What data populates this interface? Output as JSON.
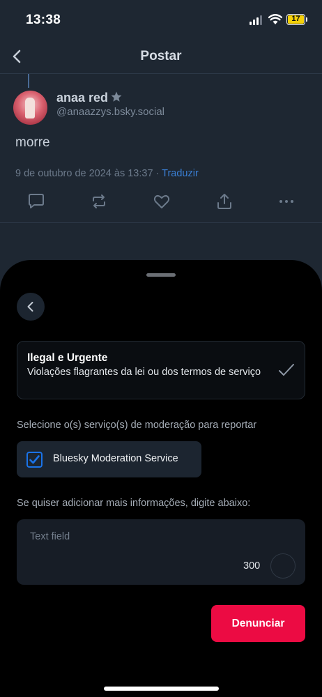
{
  "status_bar": {
    "time": "13:38",
    "battery_level": "17",
    "battery_color": "#f5d10a",
    "icons": [
      "signal-icon",
      "wifi-icon",
      "battery-icon"
    ]
  },
  "nav": {
    "title": "Postar",
    "back_icon": "chevron-left-icon"
  },
  "post": {
    "display_name": "anaa red",
    "verified_icon": "star-icon",
    "handle": "@anaazzys.bsky.social",
    "text": "morre",
    "timestamp": "9 de outubro de 2024 às 13:37",
    "separator": " · ",
    "translate_label": "Traduzir",
    "action_icons": [
      "reply-icon",
      "repost-icon",
      "like-icon",
      "share-icon",
      "more-icon"
    ]
  },
  "report_sheet": {
    "back_icon": "chevron-left-icon",
    "reason": {
      "title": "Ilegal e Urgente",
      "description": "Violações flagrantes da lei ou dos termos de serviço",
      "selected": true
    },
    "services_label": "Selecione o(s) serviço(s) de moderação para reportar",
    "service": {
      "label": "Bluesky Moderation Service",
      "checked": true
    },
    "details_label": "Se quiser adicionar mais informações, digite abaixo:",
    "textfield": {
      "placeholder": "Text field",
      "char_remaining": "300"
    },
    "submit_label": "Denunciar",
    "accent_color": "#ec0b43",
    "checkbox_color": "#1a73e8"
  }
}
